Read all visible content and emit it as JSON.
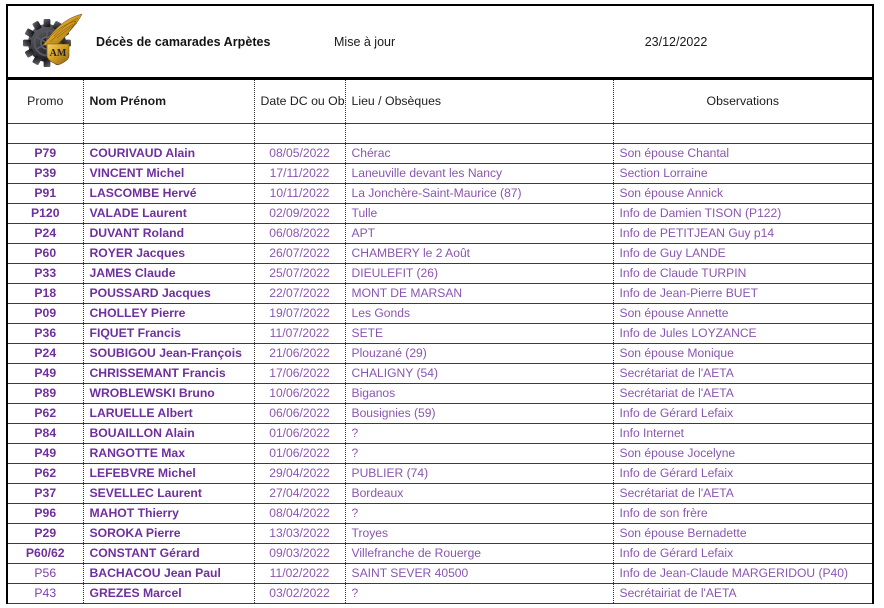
{
  "header": {
    "logo_name": "aeta-winged-cog-emblem",
    "title": "Décès de camarades Arpètes",
    "update_label": "Mise à jour",
    "update_date": "23/12/2022"
  },
  "table": {
    "columns": [
      "Promo",
      "Nom Prénom",
      "Date DC ou Obsèques",
      "Lieu / Obsèques",
      "Observations"
    ],
    "rows": [
      {
        "promo": "P79",
        "nom": "COURIVAUD Alain",
        "date": "08/05/2022",
        "lieu": "Chérac",
        "obs": "Son épouse Chantal"
      },
      {
        "promo": "P39",
        "nom": "VINCENT Michel",
        "date": "17/11/2022",
        "lieu": "Laneuville devant les Nancy",
        "obs": "Section Lorraine"
      },
      {
        "promo": "P91",
        "nom": "LASCOMBE Hervé",
        "date": "10/11/2022",
        "lieu": "La Jonchère-Saint-Maurice (87)",
        "obs": "Son épouse Annick"
      },
      {
        "promo": "P120",
        "nom": "VALADE Laurent",
        "date": "02/09/2022",
        "lieu": "Tulle",
        "obs": "Info de Damien TISON (P122)"
      },
      {
        "promo": "P24",
        "nom": "DUVANT Roland",
        "date": "06/08/2022",
        "lieu": "APT",
        "obs": "Info de PETITJEAN Guy p14"
      },
      {
        "promo": "P60",
        "nom": "ROYER Jacques",
        "date": "26/07/2022",
        "lieu": "CHAMBERY le 2 Août",
        "obs": "Info de Guy LANDE"
      },
      {
        "promo": "P33",
        "nom": "JAMES Claude",
        "date": "25/07/2022",
        "lieu": "DIEULEFIT (26)",
        "obs": "Info de Claude TURPIN"
      },
      {
        "promo": "P18",
        "nom": "POUSSARD Jacques",
        "date": "22/07/2022",
        "lieu": "MONT DE MARSAN",
        "obs": "Info de Jean-Pierre BUET"
      },
      {
        "promo": "P09",
        "nom": "CHOLLEY Pierre",
        "date": "19/07/2022",
        "lieu": "Les Gonds",
        "obs": "Son épouse Annette"
      },
      {
        "promo": "P36",
        "nom": "FIQUET Francis",
        "date": "11/07/2022",
        "lieu": "SETE",
        "obs": "Info de Jules LOYZANCE"
      },
      {
        "promo": "P24",
        "nom": "SOUBIGOU Jean-François",
        "date": "21/06/2022",
        "lieu": "Plouzané (29)",
        "obs": "Son épouse Monique"
      },
      {
        "promo": "P49",
        "nom": "CHRISSEMANT Francis",
        "date": "17/06/2022",
        "lieu": "CHALIGNY (54)",
        "obs": "Secrétariat de l'AETA"
      },
      {
        "promo": "P89",
        "nom": "WROBLEWSKI Bruno",
        "date": "10/06/2022",
        "lieu": "Biganos",
        "obs": "Secrétariat de l'AETA"
      },
      {
        "promo": "P62",
        "nom": "LARUELLE Albert",
        "date": "06/06/2022",
        "lieu": "Bousignies (59)",
        "obs": "Info de Gérard Lefaix"
      },
      {
        "promo": "P84",
        "nom": "BOUAILLON Alain",
        "date": "01/06/2022",
        "lieu": "?",
        "obs": "Info Internet"
      },
      {
        "promo": "P49",
        "nom": "RANGOTTE Max",
        "date": "01/06/2022",
        "lieu": "?",
        "obs": "Son épouse Jocelyne"
      },
      {
        "promo": "P62",
        "nom": "LEFEBVRE Michel",
        "date": "29/04/2022",
        "lieu": "PUBLIER (74)",
        "obs": "Info de Gérard Lefaix"
      },
      {
        "promo": "P37",
        "nom": "SEVELLEC Laurent",
        "date": "27/04/2022",
        "lieu": "Bordeaux",
        "obs": "Secrétariat de l'AETA"
      },
      {
        "promo": "P96",
        "nom": "MAHOT Thierry",
        "date": "08/04/2022",
        "lieu": "?",
        "obs": "Info de son frère"
      },
      {
        "promo": "P29",
        "nom": "SOROKA Pierre",
        "date": "13/03/2022",
        "lieu": "Troyes",
        "obs": "Son épouse Bernadette"
      },
      {
        "promo": "P60/62",
        "nom": "CONSTANT Gérard",
        "date": "09/03/2022",
        "lieu": "Villefranche de Rouerge",
        "obs": "Info de Gérard Lefaix"
      },
      {
        "promo": "P56",
        "nom": "BACHACOU Jean Paul",
        "date": "11/02/2022",
        "lieu": "SAINT SEVER 40500",
        "obs": "Info de Jean-Claude MARGERIDOU (P40)",
        "promo_light": true
      },
      {
        "promo": "P43",
        "nom": "GREZES Marcel",
        "date": "03/02/2022",
        "lieu": "?",
        "obs": "Secrétairiat de l'AETA",
        "promo_light": true
      }
    ]
  },
  "colors": {
    "text_bold_purple": "#6F2F9F",
    "text_purple": "#8A55B0",
    "header_text": "#1A1A1A",
    "border": "#000000",
    "logo_gold": "#E0A92A",
    "logo_dark": "#3A3A3E"
  }
}
